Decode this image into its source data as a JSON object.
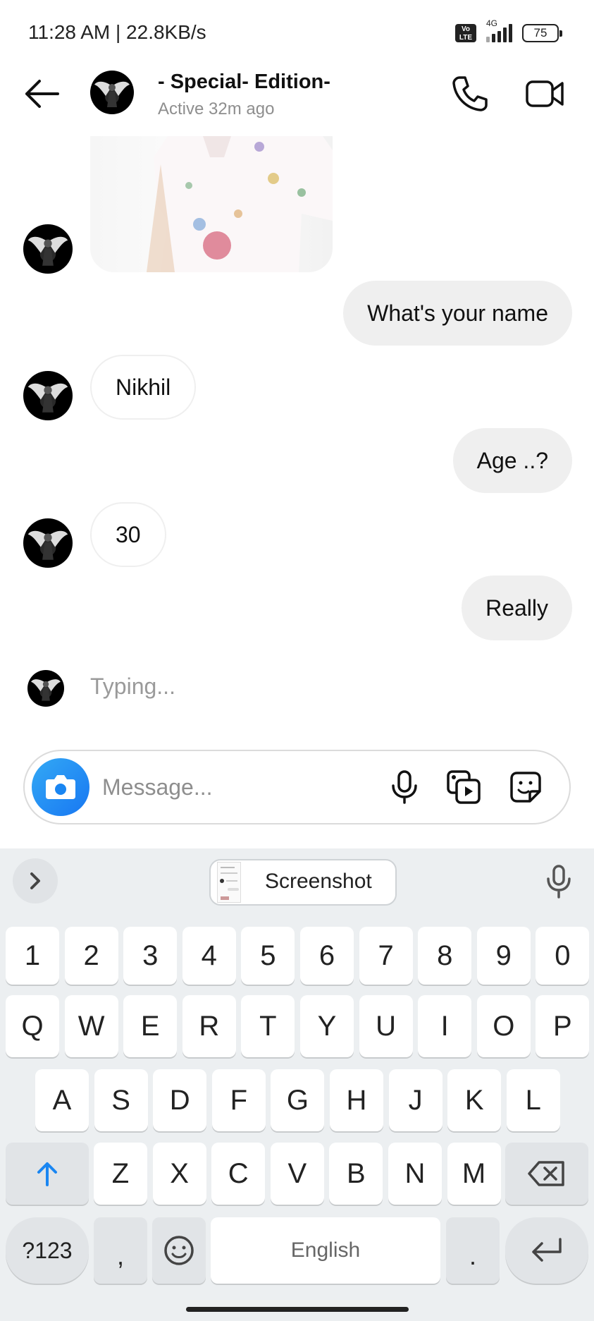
{
  "status_bar": {
    "time": "11:28 AM | 22.8KB/s",
    "volte": "Vo LTE",
    "network": "4G",
    "battery": "75"
  },
  "header": {
    "contact_name": "- Special- Edition-",
    "contact_status": "Active 32m ago",
    "back_icon": "arrow-left-icon",
    "call_icon": "phone-icon",
    "video_icon": "video-camera-icon"
  },
  "messages": [
    {
      "direction": "in",
      "type": "photo"
    },
    {
      "direction": "out",
      "text": "What's your name"
    },
    {
      "direction": "in",
      "text": "Nikhil"
    },
    {
      "direction": "out",
      "text": "Age ..?"
    },
    {
      "direction": "in",
      "text": "30"
    },
    {
      "direction": "out",
      "text": "Really"
    }
  ],
  "typing_indicator": "Typing...",
  "composer": {
    "placeholder": "Message...",
    "icons": [
      "camera-icon",
      "microphone-icon",
      "gallery-icon",
      "sticker-icon"
    ]
  },
  "keyboard": {
    "suggestion_chip": "Screenshot",
    "rows": [
      [
        "1",
        "2",
        "3",
        "4",
        "5",
        "6",
        "7",
        "8",
        "9",
        "0"
      ],
      [
        "Q",
        "W",
        "E",
        "R",
        "T",
        "Y",
        "U",
        "I",
        "O",
        "P"
      ],
      [
        "A",
        "S",
        "D",
        "F",
        "G",
        "H",
        "J",
        "K",
        "L"
      ],
      [
        "Z",
        "X",
        "C",
        "V",
        "B",
        "N",
        "M"
      ]
    ],
    "symbols_key": "?123",
    "comma_key": ",",
    "period_key": ".",
    "space_label": "English"
  },
  "colors": {
    "outgoing_bubble": "#efefef",
    "accent_blue": "#1877f2",
    "keyboard_bg": "#eceff1"
  }
}
